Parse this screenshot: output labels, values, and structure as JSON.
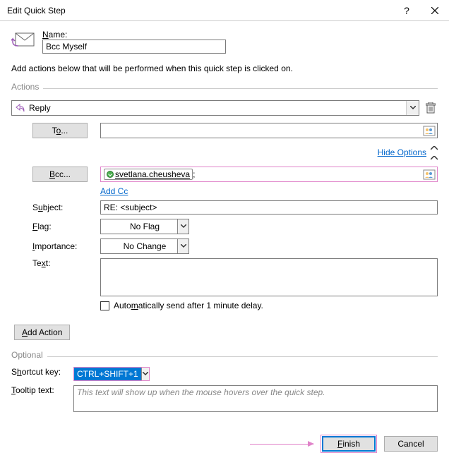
{
  "title": "Edit Quick Step",
  "name": {
    "label": "Name:",
    "value": "Bcc Myself"
  },
  "hint": "Add actions below that will be performed when this quick step is clicked on.",
  "actions_label": "Actions",
  "action": {
    "value": "Reply"
  },
  "fields": {
    "to": {
      "label": "To...",
      "value": ""
    },
    "hide_options": "Hide Options",
    "bcc": {
      "label": "Bcc...",
      "value": "svetlana.cheusheva"
    },
    "add_cc": "Add Cc",
    "subject": {
      "label": "Subject:",
      "value": "RE: <subject>"
    },
    "flag": {
      "label": "Flag:",
      "value": "No Flag"
    },
    "importance": {
      "label": "Importance:",
      "value": "No Change"
    },
    "text": {
      "label": "Text:"
    },
    "autosend": "Automatically send after 1 minute delay."
  },
  "add_action": "Add Action",
  "optional": {
    "label": "Optional",
    "shortcut": {
      "label": "Shortcut key:",
      "value": "CTRL+SHIFT+1"
    },
    "tooltip": {
      "label": "Tooltip text:",
      "placeholder": "This text will show up when the mouse hovers over the quick step."
    }
  },
  "buttons": {
    "finish": "Finish",
    "cancel": "Cancel"
  }
}
